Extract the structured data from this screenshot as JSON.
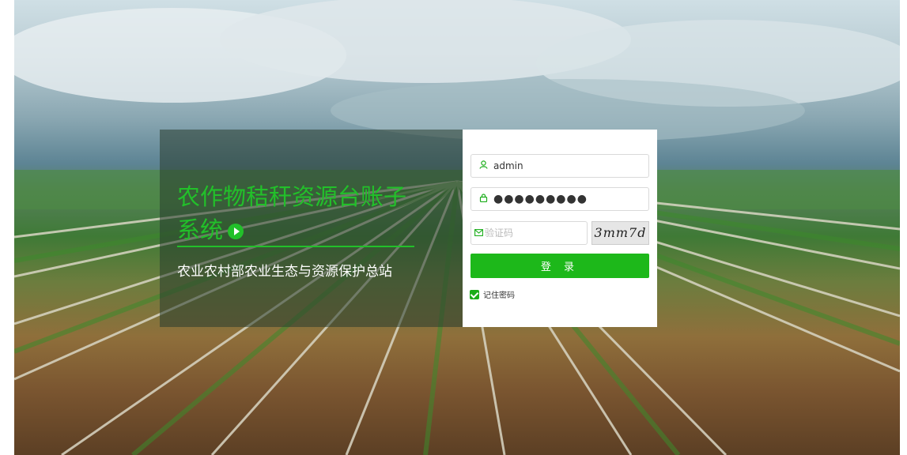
{
  "info": {
    "system_title": "农作物秸秆资源台账子系统",
    "organization": "农业农村部农业生态与资源保护总站"
  },
  "login": {
    "username_value": "admin",
    "password_value": "●●●●●●●●●",
    "captcha_placeholder": "验证码",
    "captcha_text": "3mm7d",
    "submit_label": "登 录",
    "remember_label": "记住密码",
    "remember_checked": true
  },
  "colors": {
    "brand_green": "#22c02a",
    "button_green": "#1db81a"
  }
}
